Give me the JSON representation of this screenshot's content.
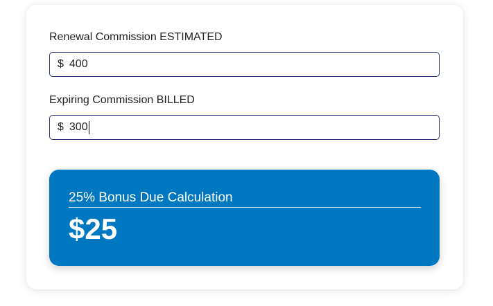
{
  "form": {
    "renewal": {
      "label": "Renewal Commission ESTIMATED",
      "currency": "$",
      "value": "400"
    },
    "expiring": {
      "label": "Expiring Commission BILLED",
      "currency": "$",
      "value": "300"
    }
  },
  "result": {
    "title": "25% Bonus Due Calculation",
    "amount": "$25"
  },
  "colors": {
    "panel_background": "#0078c1",
    "input_border": "#2b3575"
  }
}
